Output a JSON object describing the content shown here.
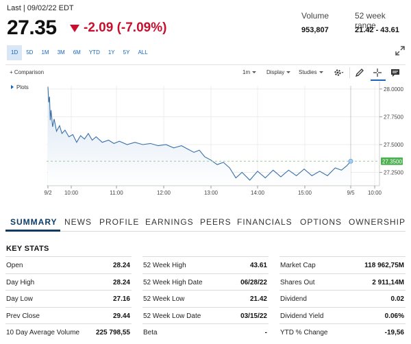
{
  "quote": {
    "last_label": "Last | 09/02/22 EDT",
    "price": "27.35",
    "change": "-2.09 (-7.09%)",
    "volume_label": "Volume",
    "volume_value": "953,807",
    "range_label": "52 week range",
    "range_value": "21.42 - 43.61",
    "down_color": "#c8102e"
  },
  "range_buttons": [
    "1D",
    "5D",
    "1M",
    "3M",
    "6M",
    "YTD",
    "1Y",
    "5Y",
    "ALL"
  ],
  "active_range": "1D",
  "toolbar": {
    "comparison": "+ Comparison",
    "interval": "1m",
    "display": "Display",
    "studies": "Studies",
    "plots": "Plots"
  },
  "chart_data": {
    "type": "area",
    "title": "",
    "xlabel": "",
    "ylabel": "",
    "x_ticks": [
      "9/2",
      "10:00",
      "11:00",
      "12:00",
      "13:00",
      "14:00",
      "15:00",
      "9/5",
      "10:00"
    ],
    "y_ticks": [
      "28.0000",
      "27.7500",
      "27.5000",
      "27.2500"
    ],
    "ylim": [
      27.13,
      28.03
    ],
    "last_price_label": "27.3500",
    "last_price": 27.35,
    "series": [
      {
        "x": [
          "09:30",
          "09:31",
          "09:32",
          "09:33",
          "09:34",
          "09:36",
          "09:38",
          "09:41",
          "09:45",
          "09:48",
          "09:52",
          "09:57",
          "10:02",
          "10:07",
          "10:12",
          "10:17",
          "10:22",
          "10:27",
          "10:32",
          "10:40",
          "10:48",
          "10:55",
          "11:02",
          "11:12",
          "11:22",
          "11:32",
          "11:42",
          "11:52",
          "12:02",
          "12:12",
          "12:22",
          "12:30",
          "12:38",
          "12:45",
          "12:52",
          "13:00",
          "13:08",
          "13:16",
          "13:24",
          "13:32",
          "13:40",
          "13:50",
          "14:00",
          "14:10",
          "14:20",
          "14:30",
          "14:40",
          "14:50",
          "15:00",
          "15:10",
          "15:20",
          "15:30",
          "15:40",
          "15:48",
          "15:55",
          "16:00"
        ],
        "y": [
          28.02,
          27.88,
          27.93,
          27.72,
          27.81,
          27.66,
          27.73,
          27.62,
          27.67,
          27.6,
          27.63,
          27.57,
          27.59,
          27.52,
          27.58,
          27.55,
          27.6,
          27.54,
          27.57,
          27.52,
          27.54,
          27.51,
          27.53,
          27.5,
          27.52,
          27.5,
          27.51,
          27.49,
          27.5,
          27.47,
          27.49,
          27.46,
          27.43,
          27.45,
          27.39,
          27.36,
          27.32,
          27.34,
          27.29,
          27.2,
          27.25,
          27.18,
          27.26,
          27.2,
          27.27,
          27.21,
          27.27,
          27.22,
          27.28,
          27.22,
          27.26,
          27.22,
          27.29,
          27.27,
          27.31,
          27.35
        ]
      }
    ],
    "line_color": "#3a6fa8",
    "area_color": "#d6e4f2",
    "price_tag_color": "#4caf50"
  },
  "tabs": [
    "SUMMARY",
    "NEWS",
    "PROFILE",
    "EARNINGS",
    "PEERS",
    "FINANCIALS",
    "OPTIONS",
    "OWNERSHIP"
  ],
  "active_tab": "SUMMARY",
  "key_stats_title": "KEY STATS",
  "key_stats": [
    [
      {
        "label": "Open",
        "value": "28.24"
      },
      {
        "label": "Day High",
        "value": "28.24"
      },
      {
        "label": "Day Low",
        "value": "27.16"
      },
      {
        "label": "Prev Close",
        "value": "29.44"
      },
      {
        "label": "10 Day Average Volume",
        "value": "225 798,55"
      }
    ],
    [
      {
        "label": "52 Week High",
        "value": "43.61"
      },
      {
        "label": "52 Week High Date",
        "value": "06/28/22"
      },
      {
        "label": "52 Week Low",
        "value": "21.42"
      },
      {
        "label": "52 Week Low Date",
        "value": "03/15/22"
      },
      {
        "label": "Beta",
        "value": "-"
      }
    ],
    [
      {
        "label": "Market Cap",
        "value": "118 962,75M"
      },
      {
        "label": "Shares Out",
        "value": "2 911,14M"
      },
      {
        "label": "Dividend",
        "value": "0.02"
      },
      {
        "label": "Dividend Yield",
        "value": "0.06%"
      },
      {
        "label": "YTD % Change",
        "value": "-19,56"
      }
    ]
  ]
}
